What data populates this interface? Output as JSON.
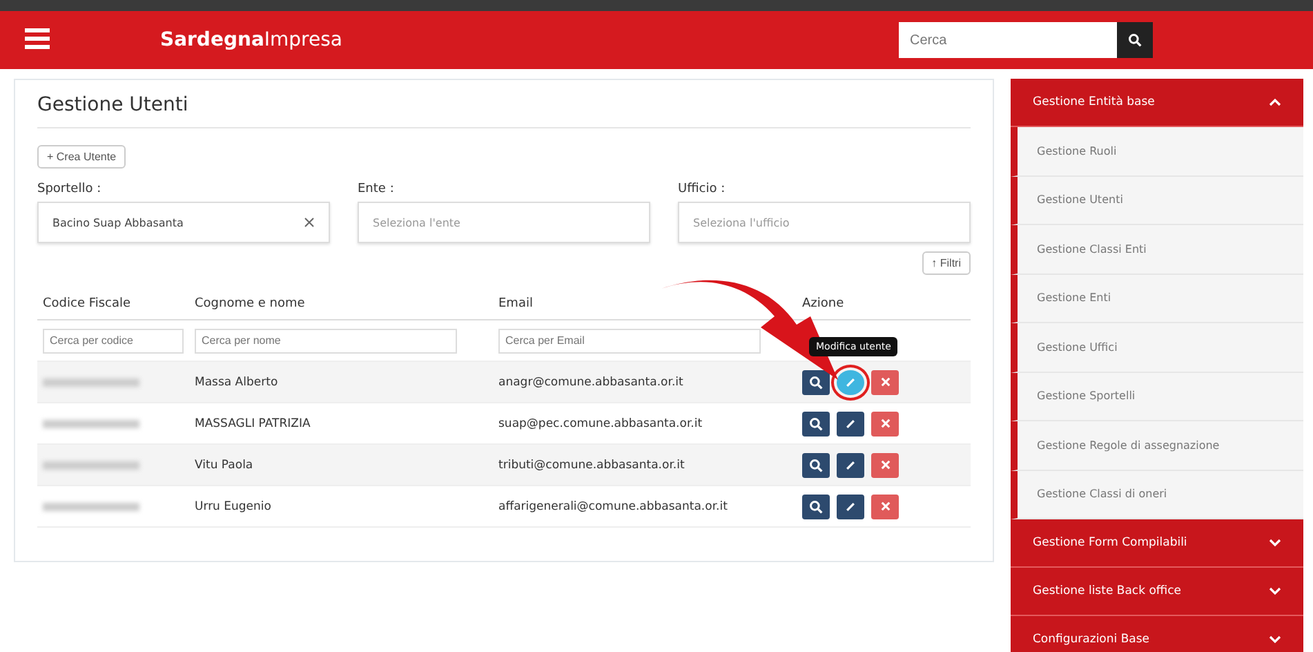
{
  "header": {
    "logo_bold": "Sardegna",
    "logo_light": "Impresa",
    "search": {
      "placeholder": "Cerca"
    }
  },
  "page": {
    "title": "Gestione Utenti",
    "create_button": "+ Crea Utente",
    "filters": [
      {
        "label": "Sportello :",
        "value": "Bacino Suap Abbasanta",
        "clearable": true
      },
      {
        "label": "Ente :",
        "placeholder": "Seleziona l'ente",
        "clearable": false
      },
      {
        "label": "Ufficio :",
        "placeholder": "Seleziona l'ufficio",
        "clearable": false
      }
    ],
    "filter_button": "↑ Filtri"
  },
  "table": {
    "columns": [
      "Codice Fiscale",
      "Cognome e nome",
      "Email",
      "Azione"
    ],
    "search_placeholders": [
      "Cerca per codice",
      "Cerca per nome",
      "Cerca per Email"
    ],
    "rows": [
      {
        "name": "Massa Alberto",
        "email": "anagr@comune.abbasanta.or.it",
        "edit_hovered": true
      },
      {
        "name": "MASSAGLI PATRIZIA",
        "email": "suap@pec.comune.abbasanta.or.it",
        "edit_hovered": false
      },
      {
        "name": "Vitu Paola",
        "email": "tributi@comune.abbasanta.or.it",
        "edit_hovered": false
      },
      {
        "name": "Urru Eugenio",
        "email": "affarigenerali@comune.abbasanta.or.it",
        "edit_hovered": false
      }
    ],
    "tooltip": "Modifica utente"
  },
  "sidebar": {
    "sections": [
      {
        "label": "Gestione Entità base",
        "expanded": true,
        "items": [
          "Gestione Ruoli",
          "Gestione Utenti",
          "Gestione Classi Enti",
          "Gestione Enti",
          "Gestione Uffici",
          "Gestione Sportelli",
          "Gestione Regole di assegnazione",
          "Gestione Classi di oneri"
        ]
      },
      {
        "label": "Gestione Form Compilabili",
        "expanded": false
      },
      {
        "label": "Gestione liste Back office",
        "expanded": false
      },
      {
        "label": "Configurazioni Base",
        "expanded": false
      }
    ]
  }
}
